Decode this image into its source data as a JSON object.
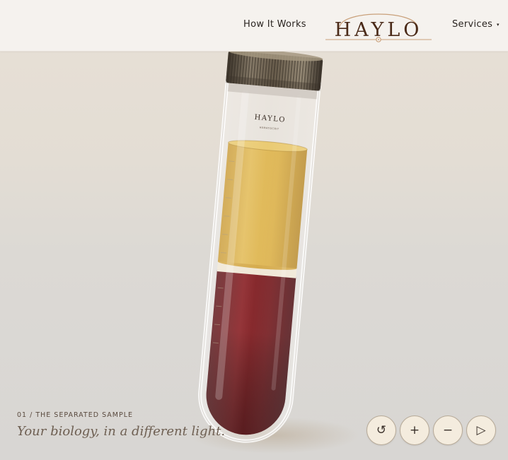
{
  "header": {
    "logo_text": "HAYLO",
    "nav_how": "How It Works",
    "nav_services": "Services",
    "services_caret": "▾"
  },
  "tube": {
    "label_brand": "HAYLO",
    "label_sub": "HEMATOCRIT"
  },
  "caption": {
    "number": "01 / THE SEPARATED SAMPLE",
    "tagline": "Your biology, in a different light."
  },
  "controls": {
    "reset": "↺",
    "zoom_in": "+",
    "zoom_out": "−",
    "play": "▷"
  },
  "colors": {
    "header_bg": "#f5f2ee",
    "logo": "#4a2a18",
    "plasma": "#dcb24c",
    "blood": "#7a1a1e",
    "cap": "#6b5f4e",
    "button_bg": "#f4ecde"
  }
}
